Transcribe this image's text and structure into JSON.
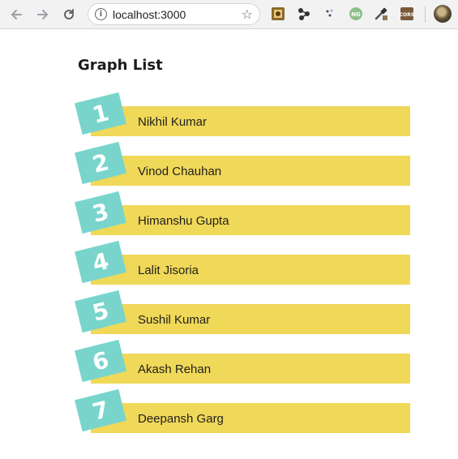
{
  "browser": {
    "url": "localhost:3000",
    "info_glyph": "i",
    "star_glyph": "☆",
    "extensions": [
      "image-extension-icon",
      "share-nodes-icon",
      "dots-extension-icon",
      "ng-extension-icon",
      "eyedropper-extension-icon",
      "cors-extension-icon"
    ]
  },
  "page": {
    "title": "Graph List",
    "items": [
      {
        "number": "1",
        "name": "Nikhil Kumar"
      },
      {
        "number": "2",
        "name": "Vinod Chauhan"
      },
      {
        "number": "3",
        "name": "Himanshu Gupta"
      },
      {
        "number": "4",
        "name": "Lalit Jisoria"
      },
      {
        "number": "5",
        "name": "Sushil Kumar"
      },
      {
        "number": "6",
        "name": "Akash Rehan"
      },
      {
        "number": "7",
        "name": "Deepansh Garg"
      }
    ]
  },
  "colors": {
    "bar": "#f0d858",
    "badge": "#79d5cc",
    "badge_text": "#ffffff"
  }
}
